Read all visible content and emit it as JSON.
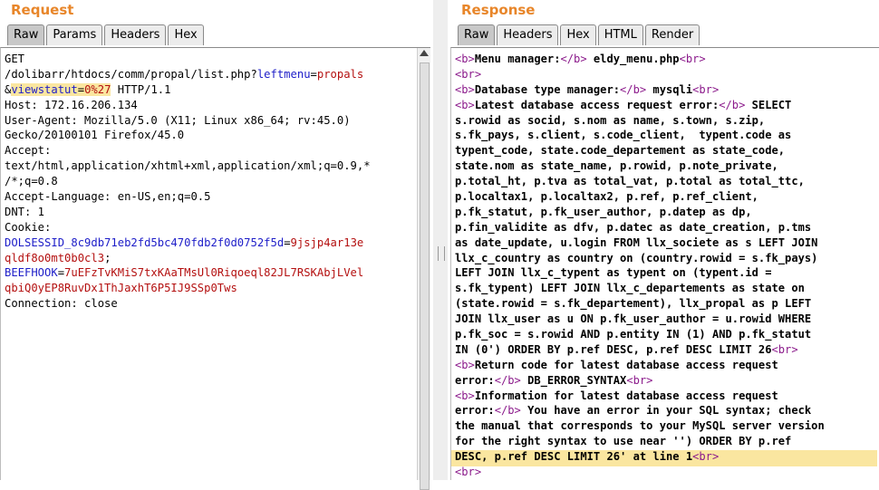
{
  "request": {
    "title": "Request",
    "tabs": [
      "Raw",
      "Params",
      "Headers",
      "Hex"
    ],
    "lines": [
      [
        {
          "t": "GET",
          "c": ""
        }
      ],
      [
        {
          "t": "/dolibarr/htdocs/comm/propal/list.php?",
          "c": ""
        },
        {
          "t": "leftmenu",
          "c": "blue"
        },
        {
          "t": "=",
          "c": ""
        },
        {
          "t": "propals",
          "c": "red"
        }
      ],
      [
        {
          "t": "&",
          "c": ""
        },
        {
          "t": "viewstatut",
          "c": "blue hl"
        },
        {
          "t": "=",
          "c": "hl"
        },
        {
          "t": "0%27",
          "c": "red hl"
        },
        {
          "t": " HTTP/1.1",
          "c": ""
        }
      ],
      [
        {
          "t": "Host: 172.16.206.134",
          "c": ""
        }
      ],
      [
        {
          "t": "User-Agent: Mozilla/5.0 (X11; Linux x86_64; rv:45.0)",
          "c": ""
        }
      ],
      [
        {
          "t": "Gecko/20100101 Firefox/45.0",
          "c": ""
        }
      ],
      [
        {
          "t": "Accept:",
          "c": ""
        }
      ],
      [
        {
          "t": "text/html,application/xhtml+xml,application/xml;q=0.9,*",
          "c": ""
        }
      ],
      [
        {
          "t": "/*;q=0.8",
          "c": ""
        }
      ],
      [
        {
          "t": "Accept-Language: en-US,en;q=0.5",
          "c": ""
        }
      ],
      [
        {
          "t": "DNT: 1",
          "c": ""
        }
      ],
      [
        {
          "t": "Cookie:",
          "c": ""
        }
      ],
      [
        {
          "t": "DOLSESSID_8c9db71eb2fd5bc470fdb2f0d0752f5d",
          "c": "blue"
        },
        {
          "t": "=",
          "c": ""
        },
        {
          "t": "9jsjp4ar13e",
          "c": "red"
        }
      ],
      [
        {
          "t": "qldf8o0mt0b0cl3",
          "c": "red"
        },
        {
          "t": ";",
          "c": ""
        }
      ],
      [
        {
          "t": "BEEFHOOK",
          "c": "blue"
        },
        {
          "t": "=",
          "c": ""
        },
        {
          "t": "7uEFzTvKMiS7txKAaTMsUl0Riqoeql82JL7RSKAbjLVel",
          "c": "red"
        }
      ],
      [
        {
          "t": "qbiQ0yEP8RuvDx1ThJaxhT6P5IJ9SSp0Tws",
          "c": "red"
        }
      ],
      [
        {
          "t": "Connection: close",
          "c": ""
        }
      ]
    ]
  },
  "response": {
    "title": "Response",
    "tabs": [
      "Raw",
      "Headers",
      "Hex",
      "HTML",
      "Render"
    ],
    "lines": [
      [
        {
          "t": "<b>",
          "c": "tagt"
        },
        {
          "t": "Menu manager:",
          "c": ""
        },
        {
          "t": "</b>",
          "c": "tagt"
        },
        {
          "t": " eldy_menu.php",
          "c": ""
        },
        {
          "t": "<br>",
          "c": "tagt"
        }
      ],
      [
        {
          "t": "<br>",
          "c": "tagt"
        }
      ],
      [
        {
          "t": "<b>",
          "c": "tagt"
        },
        {
          "t": "Database type manager:",
          "c": ""
        },
        {
          "t": "</b>",
          "c": "tagt"
        },
        {
          "t": " mysqli",
          "c": ""
        },
        {
          "t": "<br>",
          "c": "tagt"
        }
      ],
      [
        {
          "t": "<b>",
          "c": "tagt"
        },
        {
          "t": "Latest database access request error:",
          "c": ""
        },
        {
          "t": "</b>",
          "c": "tagt"
        },
        {
          "t": " SELECT",
          "c": ""
        }
      ],
      [
        {
          "t": "s.rowid as socid, s.nom as name, s.town, s.zip,",
          "c": ""
        }
      ],
      [
        {
          "t": "s.fk_pays, s.client, s.code_client,  typent.code as",
          "c": ""
        }
      ],
      [
        {
          "t": "typent_code, state.code_departement as state_code,",
          "c": ""
        }
      ],
      [
        {
          "t": "state.nom as state_name, p.rowid, p.note_private,",
          "c": ""
        }
      ],
      [
        {
          "t": "p.total_ht, p.tva as total_vat, p.total as total_ttc,",
          "c": ""
        }
      ],
      [
        {
          "t": "p.localtax1, p.localtax2, p.ref, p.ref_client,",
          "c": ""
        }
      ],
      [
        {
          "t": "p.fk_statut, p.fk_user_author, p.datep as dp,",
          "c": ""
        }
      ],
      [
        {
          "t": "p.fin_validite as dfv, p.datec as date_creation, p.tms",
          "c": ""
        }
      ],
      [
        {
          "t": "as date_update, u.login FROM llx_societe as s LEFT JOIN",
          "c": ""
        }
      ],
      [
        {
          "t": "llx_c_country as country on (country.rowid = s.fk_pays)",
          "c": ""
        }
      ],
      [
        {
          "t": "LEFT JOIN llx_c_typent as typent on (typent.id =",
          "c": ""
        }
      ],
      [
        {
          "t": "s.fk_typent) LEFT JOIN llx_c_departements as state on",
          "c": ""
        }
      ],
      [
        {
          "t": "(state.rowid = s.fk_departement), llx_propal as p LEFT",
          "c": ""
        }
      ],
      [
        {
          "t": "JOIN llx_user as u ON p.fk_user_author = u.rowid WHERE",
          "c": ""
        }
      ],
      [
        {
          "t": "p.fk_soc = s.rowid AND p.entity IN (1) AND p.fk_statut",
          "c": ""
        }
      ],
      [
        {
          "t": "IN (0') ORDER BY p.ref DESC, p.ref DESC LIMIT 26",
          "c": ""
        },
        {
          "t": "<br>",
          "c": "tagt"
        }
      ],
      [
        {
          "t": "<b>",
          "c": "tagt"
        },
        {
          "t": "Return code for latest database access request",
          "c": ""
        }
      ],
      [
        {
          "t": "error:",
          "c": ""
        },
        {
          "t": "</b>",
          "c": "tagt"
        },
        {
          "t": " DB_ERROR_SYNTAX",
          "c": ""
        },
        {
          "t": "<br>",
          "c": "tagt"
        }
      ],
      [
        {
          "t": "<b>",
          "c": "tagt"
        },
        {
          "t": "Information for latest database access request",
          "c": ""
        }
      ],
      [
        {
          "t": "error:",
          "c": ""
        },
        {
          "t": "</b>",
          "c": "tagt"
        },
        {
          "t": " You have an error in your SQL syntax; check",
          "c": ""
        }
      ],
      [
        {
          "t": "the manual that corresponds to your MySQL server version",
          "c": ""
        }
      ],
      [
        {
          "t": "for the right syntax to use near '') ORDER BY p.ref",
          "c": ""
        }
      ],
      [
        {
          "t": "DESC, p.ref DESC LIMIT 26' at line 1",
          "c": ""
        },
        {
          "t": "<br>",
          "c": "tagt"
        }
      ],
      [
        {
          "t": "<br>",
          "c": "tagt"
        }
      ]
    ]
  }
}
